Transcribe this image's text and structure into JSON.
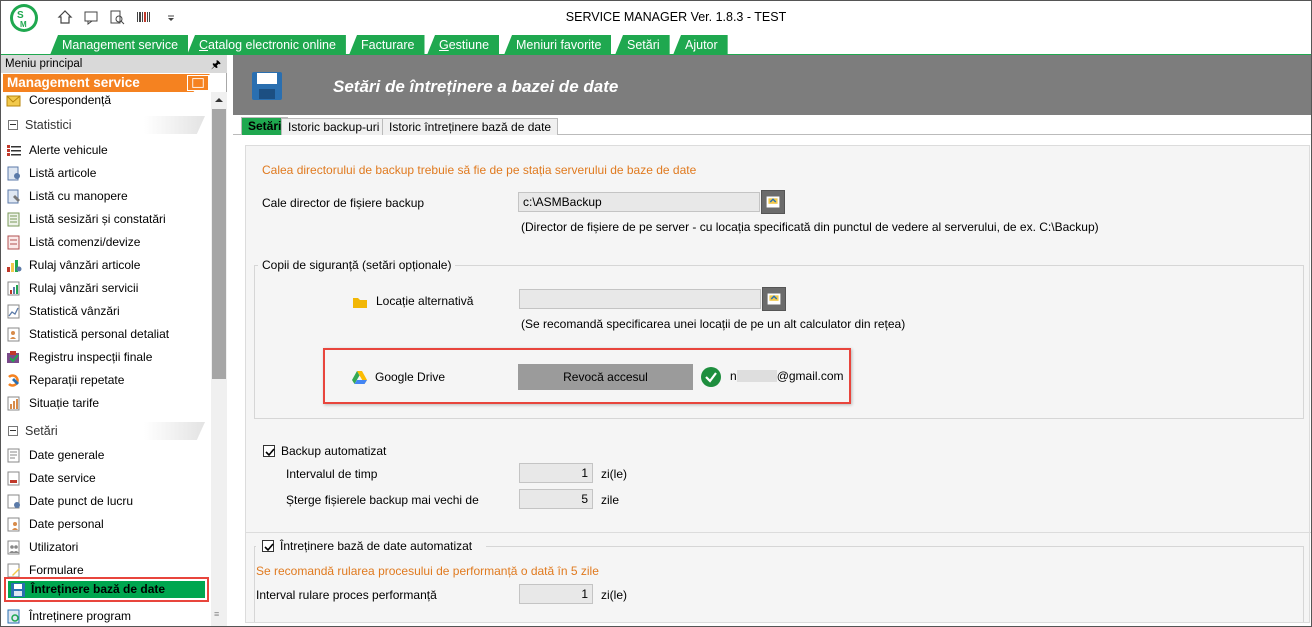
{
  "app": {
    "title": "SERVICE MANAGER Ver. 1.8.3 - TEST"
  },
  "menu": {
    "items": [
      {
        "label": "Management service"
      },
      {
        "label": "Catalog electronic online",
        "underline": "C",
        "rest": "atalog electronic online"
      },
      {
        "label": "Facturare"
      },
      {
        "label": "Gestiune",
        "underline": "G",
        "rest": "estiune"
      },
      {
        "label": "Meniuri favorite"
      },
      {
        "label": "Setări"
      },
      {
        "label": "Ajutor"
      }
    ]
  },
  "sidebar": {
    "header": "Meniu principal",
    "module": "Management service",
    "top_item": "Corespondență",
    "groups": {
      "statistici": "Statistici",
      "setari": "Setări"
    },
    "statistici_items": [
      "Alerte vehicule",
      "Listă articole",
      "Listă cu manopere",
      "Listă sesizări și constatări",
      "Listă comenzi/devize",
      "Rulaj vânzări articole",
      "Rulaj vânzări servicii",
      "Statistică vânzări",
      "Statistică personal detaliat",
      "Registru inspecții finale",
      "Reparații repetate",
      "Situație tarife"
    ],
    "setari_items": [
      "Date generale",
      "Date service",
      "Date punct de lucru",
      "Date personal",
      "Utilizatori",
      "Formulare"
    ],
    "active_item": "Întreținere bază de date",
    "bottom_item": "Întreținere program"
  },
  "content": {
    "banner_title": "Setări de întreținere a bazei de date",
    "tabs": [
      "Setări",
      "Istoric backup-uri",
      "Istoric întreținere bază de date"
    ],
    "backup_note": "Calea directorului de backup trebuie să fie de pe stația serverului de baze de date",
    "backup_dir_label": "Cale director de fișiere backup",
    "backup_dir_value": "c:\\ASMBackup",
    "backup_dir_hint": "(Director de fișiere de pe server - cu locația specificată din punctul de vedere al serverului, de ex. C:\\Backup)",
    "copies_legend": "Copii de siguranță (setări opționale)",
    "alt_location_label": "Locație alternativă",
    "alt_location_value": "",
    "alt_location_hint": "(Se recomandă specificarea unei locații de pe un alt calculator din rețea)",
    "gdrive_label": "Google Drive",
    "revoke_button": "Revocă accesul",
    "gdrive_account_prefix": "n",
    "gdrive_account_suffix": "@gmail.com",
    "auto_backup_label": "Backup automatizat",
    "interval_label": "Intervalul de timp",
    "interval_value": "1",
    "interval_unit": "zi(le)",
    "delete_label": "Șterge fișierele backup mai vechi de",
    "delete_value": "5",
    "delete_unit": "zile",
    "auto_maint_label": "Întreținere bază de date automatizat",
    "perf_note": "Se recomandă rularea procesului de performanță o dată în 5 zile",
    "perf_interval_label": "Interval rulare proces performanță",
    "perf_interval_value": "1",
    "perf_interval_unit": "zi(le)"
  },
  "colors": {
    "accent_green": "#1fa84f",
    "module_orange": "#f58220",
    "note_orange": "#e07a1f",
    "highlight_red": "#e8453c"
  }
}
